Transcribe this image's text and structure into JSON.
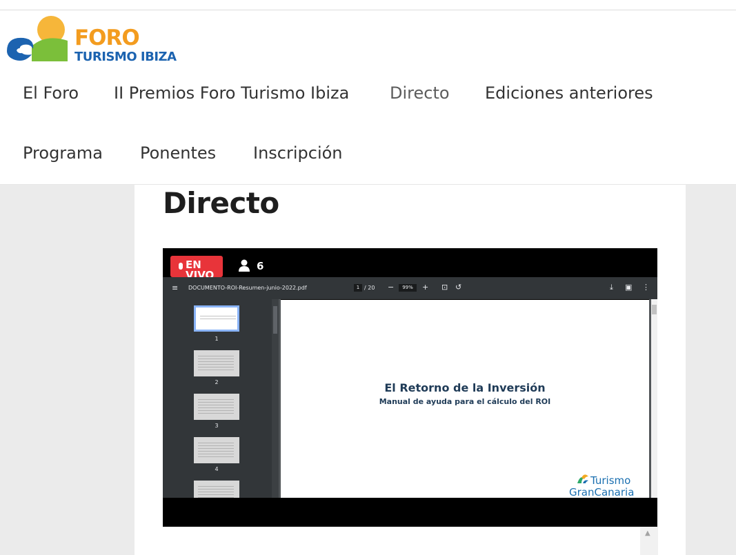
{
  "logo": {
    "line1": "FORO",
    "line2": "TURISMO IBIZA",
    "colors": {
      "sun": "#f6b63a",
      "wave": "#1c63b0",
      "land": "#7bbf3a",
      "accent": "#f39c1f"
    }
  },
  "nav": {
    "items": [
      {
        "label": "El Foro"
      },
      {
        "label": "II Premios Foro Turismo Ibiza"
      },
      {
        "label": "Directo",
        "active": true
      },
      {
        "label": "Ediciones anteriores"
      },
      {
        "label": "Programa"
      },
      {
        "label": "Ponentes"
      },
      {
        "label": "Inscripción"
      }
    ]
  },
  "page": {
    "title": "Directo"
  },
  "stream": {
    "live_label": "EN VIVO",
    "viewer_count": "6",
    "live_color": "#e8343a",
    "pdf": {
      "filename": "DOCUMENTO-ROI-Resumen-junio-2022.pdf",
      "current_page": "1",
      "total_pages": "/ 20",
      "zoom": "99%",
      "thumbnails": [
        "1",
        "2",
        "3",
        "4"
      ],
      "doc_title": "El Retorno de la Inversión",
      "doc_subtitle": "Manual de ayuda para el cálculo del ROI",
      "brand_line1": "Turismo",
      "brand_line2": "GranCanaria"
    }
  }
}
